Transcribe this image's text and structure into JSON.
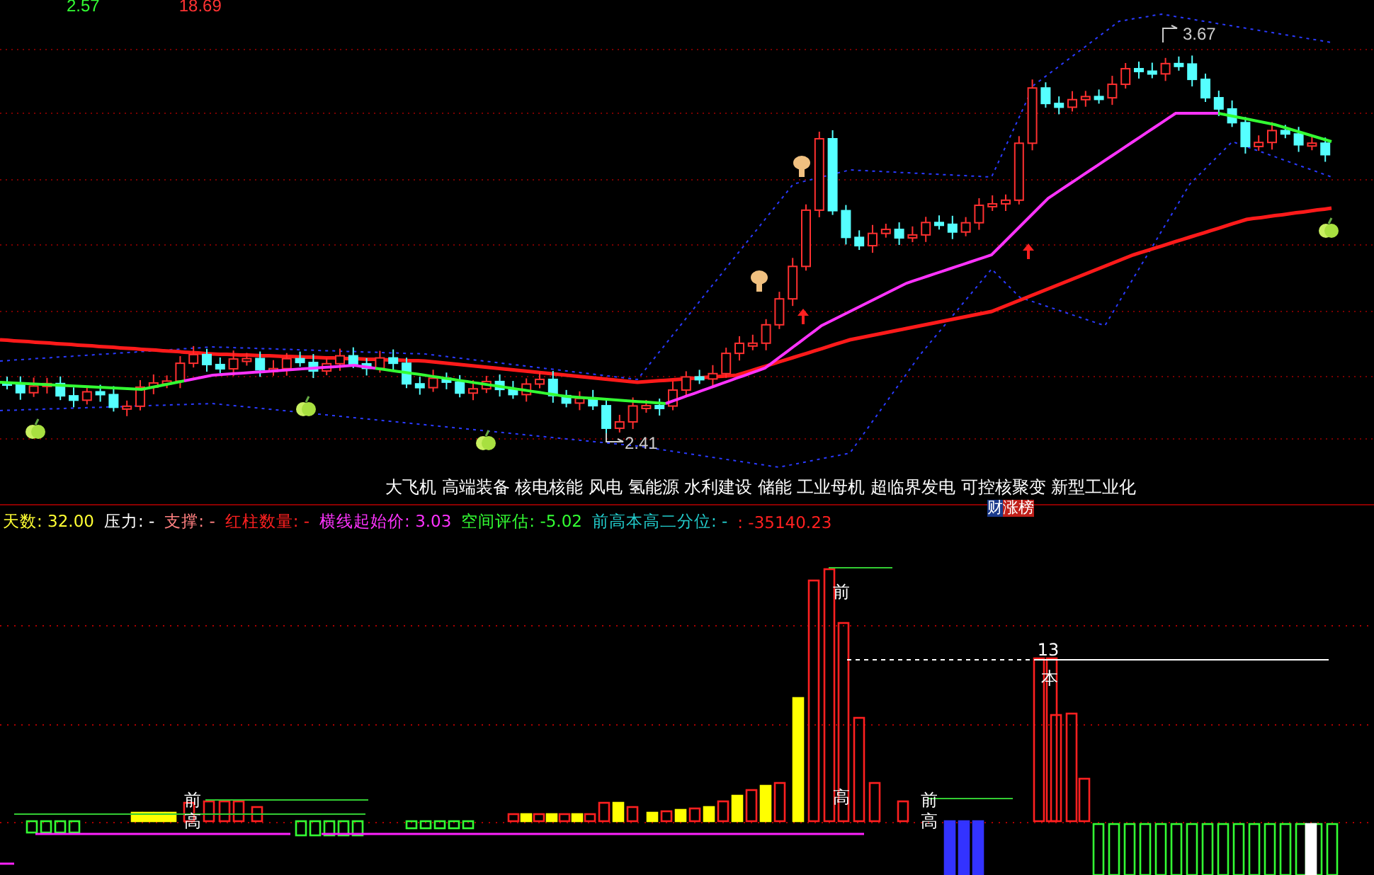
{
  "top_values": [
    {
      "text": "2.57",
      "color": "#33ff33"
    },
    {
      "text": "18.69",
      "color": "#ff3333"
    }
  ],
  "price_chart": {
    "high_label": "3.67",
    "low_label": "2.41",
    "sectors": "大飞机 高端装备 核电核能 风电 氢能源 水利建设 储能 工业母机 超临界发电 可控核聚变 新型工业化",
    "badge": [
      {
        "text": "财",
        "color": "#1a3a8c"
      },
      {
        "text": "涨榜",
        "color": "#c0201a"
      }
    ]
  },
  "indicator_header": [
    {
      "label": "天数:",
      "value": "32.00",
      "color": "#ffff33"
    },
    {
      "label": "压力:",
      "value": "-",
      "color": "#ffffff"
    },
    {
      "label": "支撑:",
      "value": "-",
      "color": "#ff8080"
    },
    {
      "label": "红柱数量:",
      "value": "-",
      "color": "#ff2020"
    },
    {
      "label": "横线起始价:",
      "value": "3.03",
      "color": "#ff33ff"
    },
    {
      "label": "空间评估:",
      "value": "-5.02",
      "color": "#33ff33"
    },
    {
      "label": "前高本高二分位:",
      "value": "-",
      "color": "#22cccc"
    },
    {
      "value": ": -35140.23",
      "color": "#ff2020"
    }
  ],
  "histogram_labels": [
    "前",
    "高",
    "前",
    "高",
    "前",
    "高",
    "13",
    "本"
  ]
}
